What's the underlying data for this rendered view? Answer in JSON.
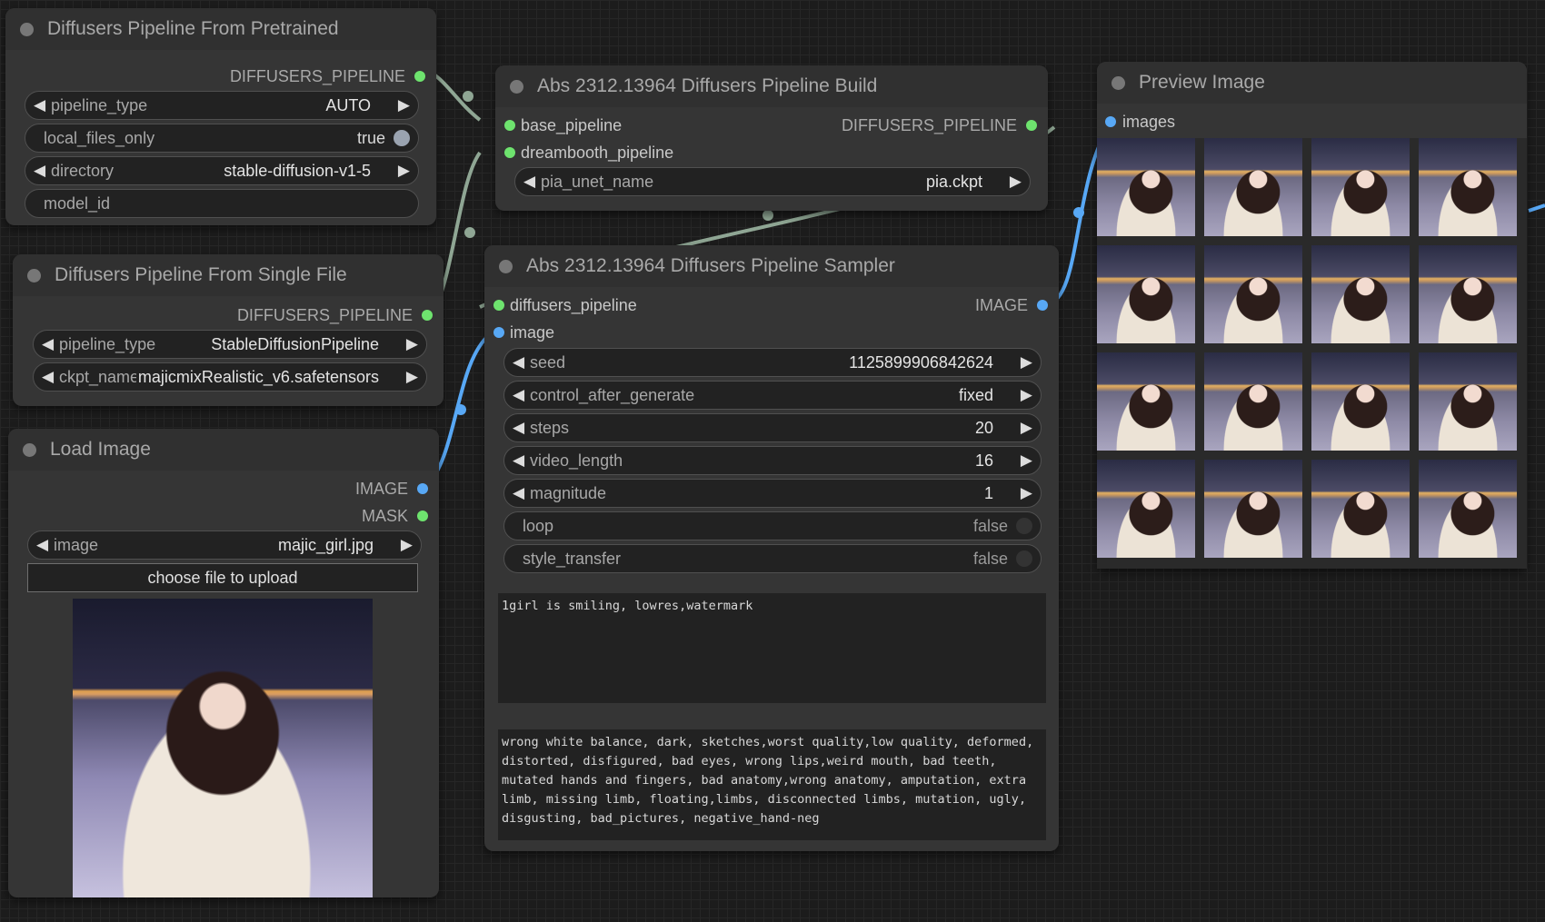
{
  "nodes": {
    "from_pretrained": {
      "title": "Diffusers Pipeline From Pretrained",
      "output": "DIFFUSERS_PIPELINE",
      "pipeline_type": {
        "label": "pipeline_type",
        "value": "AUTO"
      },
      "local_files_only": {
        "label": "local_files_only",
        "value": "true"
      },
      "directory": {
        "label": "directory",
        "value": "stable-diffusion-v1-5"
      },
      "model_id": {
        "label": "model_id"
      }
    },
    "from_single_file": {
      "title": "Diffusers Pipeline From Single File",
      "output": "DIFFUSERS_PIPELINE",
      "pipeline_type": {
        "label": "pipeline_type",
        "value": "StableDiffusionPipeline"
      },
      "ckpt_name": {
        "label": "ckpt_name",
        "value": "majicmixRealistic_v6.safetensors"
      }
    },
    "load_image": {
      "title": "Load Image",
      "outputs": [
        "IMAGE",
        "MASK"
      ],
      "image": {
        "label": "image",
        "value": "majic_girl.jpg"
      },
      "upload_button": "choose file to upload"
    },
    "pipeline_build": {
      "title": "Abs 2312.13964 Diffusers Pipeline Build",
      "inputs": [
        "base_pipeline",
        "dreambooth_pipeline"
      ],
      "output": "DIFFUSERS_PIPELINE",
      "pia_unet_name": {
        "label": "pia_unet_name",
        "value": "pia.ckpt"
      }
    },
    "pipeline_sampler": {
      "title": "Abs 2312.13964 Diffusers Pipeline Sampler",
      "inputs": [
        "diffusers_pipeline",
        "image"
      ],
      "output": "IMAGE",
      "widgets": [
        {
          "label": "seed",
          "value": "1125899906842624"
        },
        {
          "label": "control_after_generate",
          "value": "fixed"
        },
        {
          "label": "steps",
          "value": "20"
        },
        {
          "label": "video_length",
          "value": "16"
        },
        {
          "label": "magnitude",
          "value": "1"
        }
      ],
      "toggles": [
        {
          "label": "loop",
          "value": "false"
        },
        {
          "label": "style_transfer",
          "value": "false"
        }
      ],
      "positive_prompt": "1girl is smiling, lowres,watermark",
      "negative_prompt": "wrong white balance, dark, sketches,worst quality,low quality, deformed, distorted, disfigured, bad eyes, wrong lips,weird mouth, bad teeth, mutated hands and fingers, bad anatomy,wrong anatomy, amputation, extra limb, missing limb, floating,limbs, disconnected limbs, mutation, ugly, disgusting, bad_pictures, negative_hand-neg"
    },
    "preview_image": {
      "title": "Preview Image",
      "input": "images"
    }
  },
  "colors": {
    "pipeline_socket": "#6ee36e",
    "image_socket": "#58a8f5",
    "node_bg": "#353535",
    "canvas_bg": "#1c1c1c"
  }
}
